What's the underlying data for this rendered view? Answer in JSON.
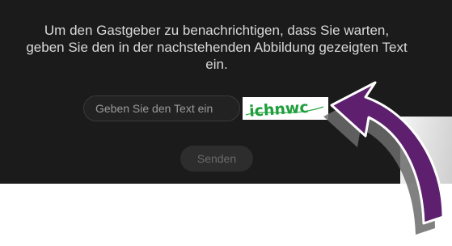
{
  "dialog": {
    "instruction": "Um den Gastgeber zu benachrichtigen, dass Sie warten, geben Sie den in der nachstehenden Abbildung gezeigten Text ein.",
    "input_placeholder": "Geben Sie den Text ein",
    "input_value": "",
    "captcha_text": "ichnwc",
    "send_label": "Senden"
  },
  "colors": {
    "dialog_background": "#1b1b1b",
    "instruction_text": "#d9d9d9",
    "captcha_text": "#1f9e3c",
    "arrow_fill": "#5e1f6e",
    "arrow_shadow": "#6b6b6b"
  },
  "icons": {
    "annotation": "curved-arrow-icon"
  }
}
